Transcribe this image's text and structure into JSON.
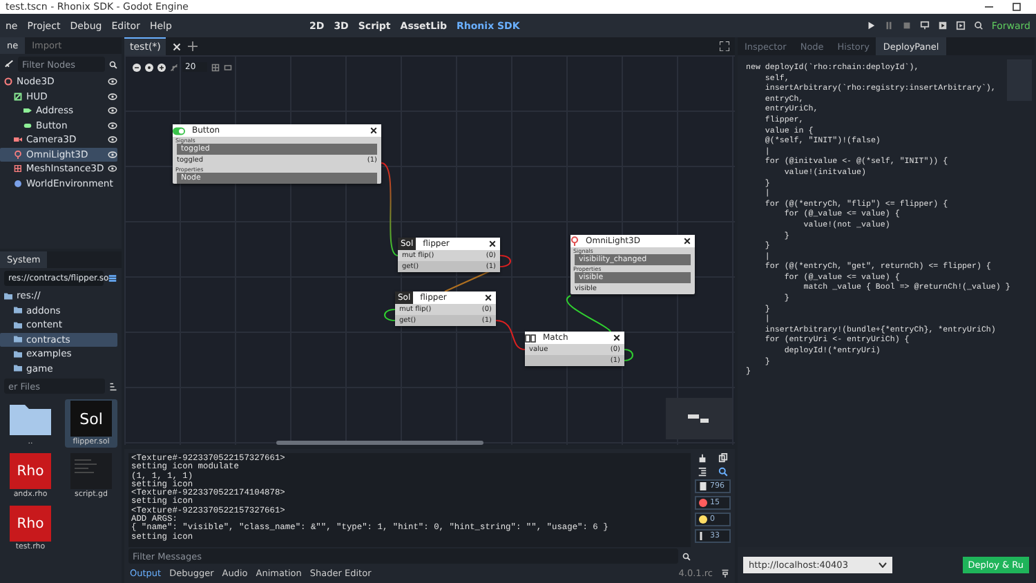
{
  "window": {
    "title": "test.tscn - Rhonix SDK - Godot Engine"
  },
  "menu": [
    "ne",
    "Project",
    "Debug",
    "Editor",
    "Help"
  ],
  "workspaces": [
    {
      "label": "2D",
      "selected": false
    },
    {
      "label": "3D",
      "selected": false
    },
    {
      "label": "Script",
      "selected": false
    },
    {
      "label": "AssetLib",
      "selected": false
    },
    {
      "label": "Rhonix SDK",
      "selected": true
    }
  ],
  "renderer": "Forward",
  "scene_dock": {
    "tabs": [
      {
        "label": "ne",
        "selected": true
      },
      {
        "label": "Import",
        "selected": false
      }
    ],
    "filter": {
      "placeholder": "Filter Nodes"
    },
    "tree": [
      {
        "label": "Node3D",
        "kind": "node3d",
        "selected": false,
        "eye": true,
        "children": [
          {
            "label": "HUD",
            "kind": "control",
            "selected": false,
            "eye": true,
            "children": [
              {
                "label": "Address",
                "kind": "label",
                "selected": false,
                "eye": true
              },
              {
                "label": "Button",
                "kind": "button",
                "selected": false,
                "eye": true
              }
            ]
          },
          {
            "label": "Camera3D",
            "kind": "camera",
            "selected": false,
            "eye": true
          },
          {
            "label": "OmniLight3D",
            "kind": "light",
            "selected": true,
            "eye": true
          },
          {
            "label": "MeshInstance3D",
            "kind": "mesh",
            "selected": false,
            "eye": true
          },
          {
            "label": "WorldEnvironment",
            "kind": "environment",
            "selected": false,
            "eye": false
          }
        ]
      }
    ]
  },
  "filesystem": {
    "tab": "System",
    "path": "res://contracts/flipper.so",
    "tree": [
      {
        "label": "res://",
        "selected": false,
        "children": [
          {
            "label": "addons",
            "selected": false
          },
          {
            "label": "content",
            "selected": false
          },
          {
            "label": "contracts",
            "selected": true
          },
          {
            "label": "examples",
            "selected": false
          },
          {
            "label": "game",
            "selected": false
          }
        ]
      }
    ],
    "filter": {
      "placeholder": "er Files"
    },
    "files": [
      {
        "name": "..",
        "kind": "folder",
        "selected": false
      },
      {
        "name": "flipper.sol",
        "kind": "sol",
        "thumb": "Sol",
        "selected": true
      },
      {
        "name": "andx.rho",
        "kind": "rho",
        "thumb": "Rho",
        "selected": false
      },
      {
        "name": "script.gd",
        "kind": "script",
        "selected": false
      },
      {
        "name": "test.rho",
        "kind": "rho",
        "thumb": "Rho",
        "selected": false
      }
    ]
  },
  "editor_tabs": [
    {
      "label": "test(*)",
      "selected": true
    }
  ],
  "canvas": {
    "zoom": "20",
    "nodes": [
      {
        "kind": "signal",
        "title": "Button",
        "signals_label": "Signals",
        "signal": "toggled",
        "properties_label": "Properties",
        "property": "Node",
        "rows": [
          {
            "label": "toggled",
            "index": "(1)"
          }
        ]
      },
      {
        "kind": "sol",
        "badge": "Sol",
        "title": "flipper",
        "rows": [
          {
            "label": "mut flip()",
            "index": "(0)"
          },
          {
            "label": "get()",
            "index": "(1)"
          }
        ]
      },
      {
        "kind": "sol",
        "badge": "Sol",
        "title": "flipper",
        "rows": [
          {
            "label": "mut flip()",
            "index": "(0)"
          },
          {
            "label": "get()",
            "index": "(1)"
          }
        ]
      },
      {
        "kind": "signal",
        "title": "OmniLight3D",
        "signals_label": "Signals",
        "signal": "visibility_changed",
        "properties_label": "Properties",
        "property": "visible",
        "rows": [
          {
            "label": "visible"
          }
        ]
      },
      {
        "kind": "match",
        "title": "Match",
        "rows": [
          {
            "label": "value",
            "index": "(0)"
          },
          {
            "index": "(1)"
          }
        ]
      }
    ]
  },
  "console": {
    "lines": [
      "<Texture#-9223370522157327661>",
      "setting icon modulate",
      "(1, 1, 1, 1)",
      "setting icon",
      "<Texture#-9223370522174104878>",
      "setting icon",
      "<Texture#-9223370522157327661>",
      "ADD ARGS:",
      "{ \"name\": \"visible\", \"class_name\": &\"\", \"type\": 1, \"hint\": 0, \"hint_string\": \"\", \"usage\": 6 }",
      "setting icon"
    ],
    "filter": {
      "placeholder": "Filter Messages"
    },
    "counts": [
      {
        "kind": "message",
        "value": "796"
      },
      {
        "kind": "error",
        "value": "15"
      },
      {
        "kind": "warning",
        "value": "0"
      },
      {
        "kind": "info",
        "value": "33"
      }
    ],
    "tabs": [
      {
        "label": "Output",
        "selected": true
      },
      {
        "label": "Debugger",
        "selected": false
      },
      {
        "label": "Audio",
        "selected": false
      },
      {
        "label": "Animation",
        "selected": false
      },
      {
        "label": "Shader Editor",
        "selected": false
      }
    ],
    "version": "4.0.1.rc"
  },
  "inspector": {
    "tabs": [
      {
        "label": "Inspector",
        "selected": false
      },
      {
        "label": "Node",
        "selected": false
      },
      {
        "label": "History",
        "selected": false
      },
      {
        "label": "DeployPanel",
        "selected": true
      }
    ],
    "code": [
      "new deployId(`rho:rchain:deployId`),",
      "    self,",
      "    insertArbitrary(`rho:registry:insertArbitrary`),",
      "    entryCh,",
      "    entryUriCh,",
      "    flipper,",
      "    value in {",
      "    @(*self, \"INIT\")!(false)",
      "    |",
      "    for (@initvalue <- @(*self, \"INIT\")) {",
      "        value!(initvalue)",
      "    }",
      "    |",
      "    for (@(*entryCh, \"flip\") <= flipper) {",
      "        for (@_value <= value) {",
      "            value!(not _value)",
      "        }",
      "    }",
      "    |",
      "    for (@(*entryCh, \"get\", returnCh) <= flipper) {",
      "        for (@_value <= value) {",
      "            match _value { Bool => @returnCh!(_value) }",
      "        }",
      "    }",
      "    |",
      "    insertArbitrary!(bundle+{*entryCh}, *entryUriCh)",
      "    for (entryUri <- entryUriCh) {",
      "        deployId!(*entryUri)",
      "    }",
      "}"
    ],
    "url": "http://localhost:40403",
    "deploy_button": "Deploy & Ru"
  }
}
